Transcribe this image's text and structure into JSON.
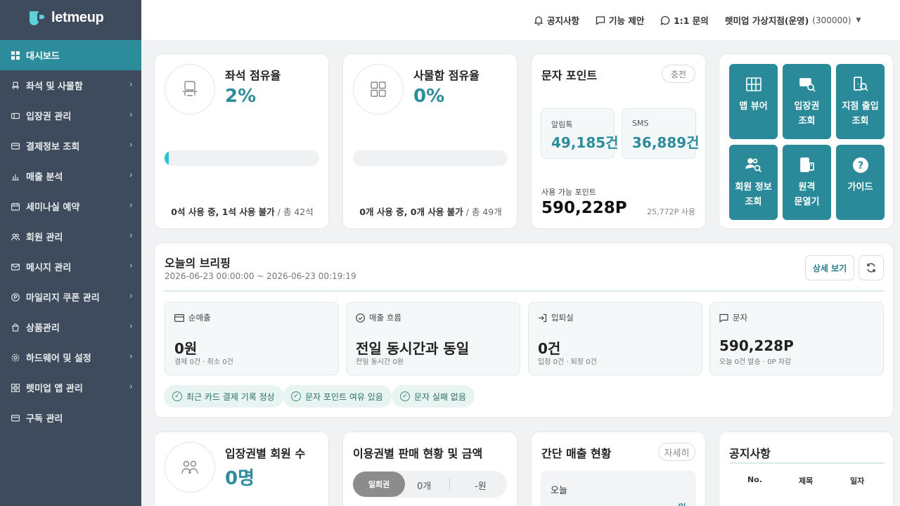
{
  "brand": {
    "name": "letmeup"
  },
  "sidebar": {
    "items": [
      {
        "label": "대시보드"
      },
      {
        "label": "좌석 및 사물함"
      },
      {
        "label": "입장권 관리"
      },
      {
        "label": "결제정보 조회"
      },
      {
        "label": "매출 분석"
      },
      {
        "label": "세미나실 예약"
      },
      {
        "label": "회원 관리"
      },
      {
        "label": "메시지 관리"
      },
      {
        "label": "마일리지 쿠폰 관리"
      },
      {
        "label": "상품관리"
      },
      {
        "label": "하드웨어 및 설정"
      },
      {
        "label": "렛미업 앱 관리"
      },
      {
        "label": "구독 관리"
      }
    ]
  },
  "header": {
    "notice": "공지사항",
    "suggest": "기능 제안",
    "inquiry": "1:1 문의",
    "branch": "렛미업 가상지점(운영)",
    "branch_code": "(300000)"
  },
  "seat": {
    "title": "좌석 점유율",
    "percent": "2%",
    "progress": 2,
    "used": "0석 사용 중, 1석 사용 불가",
    "total": " / 총 42석"
  },
  "locker": {
    "title": "사물함 점유율",
    "percent": "0%",
    "progress": 0,
    "used": "0개 사용 중, 0개 사용 불가",
    "total": " / 총 49개"
  },
  "sms": {
    "title": "문자 포인트",
    "charge": "충전",
    "alimtalk_label": "알림톡",
    "alimtalk_value": "49,185건",
    "sms_label": "SMS",
    "sms_value": "36,889건",
    "avail_label": "사용 가능 포인트",
    "avail_value": "590,228P",
    "used": "25,772P 사용"
  },
  "quick": [
    {
      "line1": "맵 뷰어",
      "line2": ""
    },
    {
      "line1": "입장권",
      "line2": "조회"
    },
    {
      "line1": "지점 출입",
      "line2": "조회"
    },
    {
      "line1": "회원 정보",
      "line2": "조회"
    },
    {
      "line1": "원격",
      "line2": "문열기"
    },
    {
      "line1": "가이드",
      "line2": ""
    }
  ],
  "briefing": {
    "title": "오늘의 브리핑",
    "range": "2026-06-23 00:00:00 ~ 2026-06-23 00:19:19",
    "detail": "상세 보기",
    "cards": [
      {
        "label": "순매출",
        "value": "0원",
        "sub": "결제 0건 · 취소 0건"
      },
      {
        "label": "매출 흐름",
        "value": "전일 동시간과 동일",
        "sub": "전일 동시간 0원"
      },
      {
        "label": "입퇴실",
        "value": "0건",
        "sub": "입장 0건 · 퇴장 0건"
      },
      {
        "label": "문자",
        "value": "590,228P",
        "sub": "오늘 0건 발송 · 0P 차감"
      }
    ],
    "chips": [
      "최근 카드 결제 기록 정상",
      "문자 포인트 여유 있음",
      "문자 실패 없음"
    ]
  },
  "members": {
    "title": "입장권별 회원 수",
    "value": "0명"
  },
  "sales": {
    "title": "이용권별 판매 현황 및 금액",
    "tab": "일회권",
    "count": "0개",
    "amount": "-원"
  },
  "simple": {
    "title": "간단 매출 현황",
    "detail": "자세히",
    "today": "오늘",
    "today_amount": "-원"
  },
  "notice": {
    "title": "공지사항",
    "col_no": "No.",
    "col_title": "제목",
    "col_date": "일자"
  }
}
